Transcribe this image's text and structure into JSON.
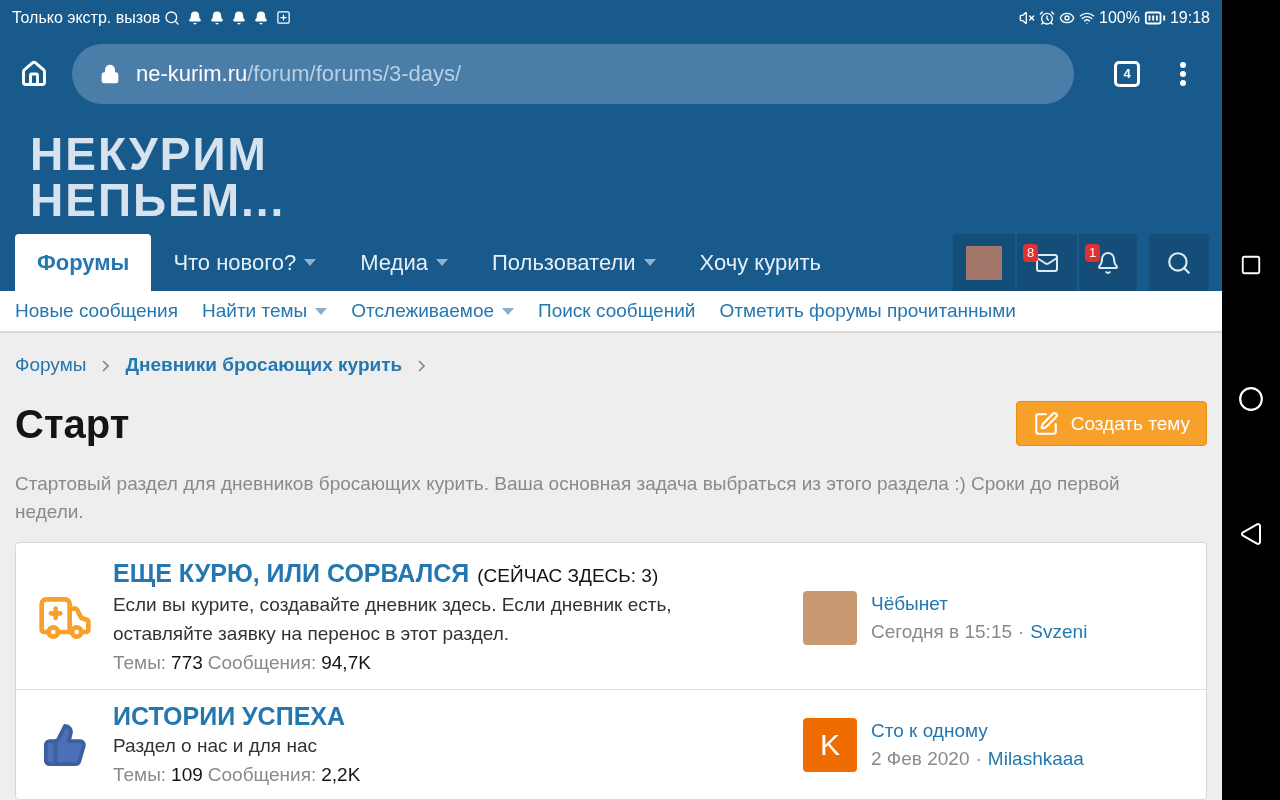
{
  "status_bar": {
    "carrier": "Только экстр. вызов",
    "battery": "100%",
    "time": "19:18"
  },
  "browser": {
    "url_host": "ne-kurim.ru",
    "url_path": "/forum/forums/3-days/",
    "tab_count": "4"
  },
  "logo": [
    "НЕКУРИМ",
    "НЕПЬЕМ..."
  ],
  "nav": {
    "tabs": [
      {
        "label": "Форумы",
        "selected": true,
        "dropdown": false
      },
      {
        "label": "Что нового?",
        "selected": false,
        "dropdown": true
      },
      {
        "label": "Медиа",
        "selected": false,
        "dropdown": true
      },
      {
        "label": "Пользователи",
        "selected": false,
        "dropdown": true
      },
      {
        "label": "Хочу курить",
        "selected": false,
        "dropdown": false
      }
    ],
    "messages_badge": "8",
    "alerts_badge": "1"
  },
  "subnav": [
    {
      "label": "Новые сообщения",
      "dropdown": false
    },
    {
      "label": "Найти темы",
      "dropdown": true
    },
    {
      "label": "Отслеживаемое",
      "dropdown": true
    },
    {
      "label": "Поиск сообщений",
      "dropdown": false
    },
    {
      "label": "Отметить форумы прочитанными",
      "dropdown": false
    }
  ],
  "breadcrumbs": [
    "Форумы",
    "Дневники бросающих курить"
  ],
  "title": "Старт",
  "create_button": "Создать тему",
  "description": "Стартовый раздел для дневников бросающих курить. Ваша основная задача выбраться из этого раздела :) Сроки до первой недели.",
  "forums": [
    {
      "kind": "ambulance",
      "title": "ЕЩЕ КУРЮ, ИЛИ СОРВАЛСЯ",
      "suffix": "(СЕЙЧАС ЗДЕСЬ: 3)",
      "description": "Если вы курите, создавайте дневник здесь. Если дневник есть, оставляйте заявку на перенос в этот раздел.",
      "stats": [
        {
          "label": "Темы:",
          "value": "773"
        },
        {
          "label": "Сообщения:",
          "value": "94,7K"
        }
      ],
      "last": {
        "kind": "photo",
        "separator": "·",
        "thread": "Чёбынет",
        "date": "Сегодня в 15:15",
        "user": "Svzeni"
      }
    },
    {
      "kind": "thumbs",
      "title": "ИСТОРИИ УСПЕХА",
      "description": "Раздел о нас и для нас",
      "stats": [
        {
          "label": "Темы:",
          "value": "109"
        },
        {
          "label": "Сообщения:",
          "value": "2,2K"
        }
      ],
      "last": {
        "kind": "letter",
        "separator": "·",
        "letter": "K",
        "thread": "Сто к одному",
        "date": "2 Фев 2020",
        "user": "Milashkaaa"
      }
    }
  ]
}
